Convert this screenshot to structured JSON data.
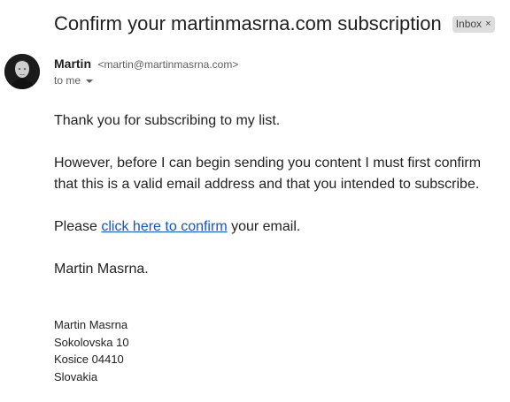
{
  "email": {
    "subject": "Confirm your martinmasrna.com subscription",
    "label": "Inbox",
    "label_close": "×",
    "sender": {
      "name": "Martin",
      "email": "<martin@martinmasrna.com>"
    },
    "recipient": "to me",
    "body": {
      "para1": "Thank you for subscribing to my list.",
      "para2": "However, before I can begin sending you content I must first confirm that this is a valid email address and that you intended to subscribe.",
      "para3_prefix": "Please ",
      "confirm_link": "click here to confirm",
      "para3_suffix": " your email.",
      "closing": "Martin Masrna."
    },
    "signature": {
      "line1": "Martin Masrna",
      "line2": "Sokolovska 10",
      "line3": "Kosice 04410",
      "line4": "Slovakia"
    }
  },
  "colors": {
    "link": "#1155cc",
    "chip_bg": "#dddddd"
  }
}
